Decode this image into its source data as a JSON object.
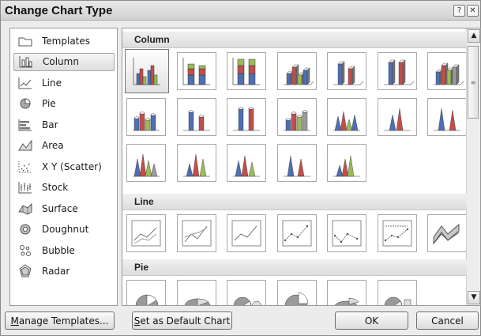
{
  "window": {
    "title": "Change Chart Type",
    "help_glyph": "?",
    "close_glyph": "✕"
  },
  "chart_types": [
    {
      "label": "Templates",
      "icon": "folder-icon"
    },
    {
      "label": "Column",
      "icon": "column-chart-icon",
      "selected": true
    },
    {
      "label": "Line",
      "icon": "line-chart-icon"
    },
    {
      "label": "Pie",
      "icon": "pie-chart-icon"
    },
    {
      "label": "Bar",
      "icon": "bar-chart-icon"
    },
    {
      "label": "Area",
      "icon": "area-chart-icon"
    },
    {
      "label": "X Y (Scatter)",
      "icon": "scatter-chart-icon"
    },
    {
      "label": "Stock",
      "icon": "stock-chart-icon"
    },
    {
      "label": "Surface",
      "icon": "surface-chart-icon"
    },
    {
      "label": "Doughnut",
      "icon": "doughnut-chart-icon"
    },
    {
      "label": "Bubble",
      "icon": "bubble-chart-icon"
    },
    {
      "label": "Radar",
      "icon": "radar-chart-icon"
    }
  ],
  "gallery": {
    "sections": [
      {
        "title": "Column",
        "count": 19
      },
      {
        "title": "Line",
        "count": 7
      },
      {
        "title": "Pie",
        "count": 6
      }
    ]
  },
  "buttons": {
    "manage_templates_prefix": "",
    "manage_templates_mnemonic": "M",
    "manage_templates_rest": "anage Templates...",
    "set_default_mnemonic": "S",
    "set_default_rest": "et as Default Chart",
    "ok": "OK",
    "cancel": "Cancel"
  },
  "colors": {
    "bar_blue": "#4f6fb3",
    "bar_red": "#c0504d",
    "bar_green": "#9bbb59",
    "bar_gray": "#9a9a9a"
  }
}
